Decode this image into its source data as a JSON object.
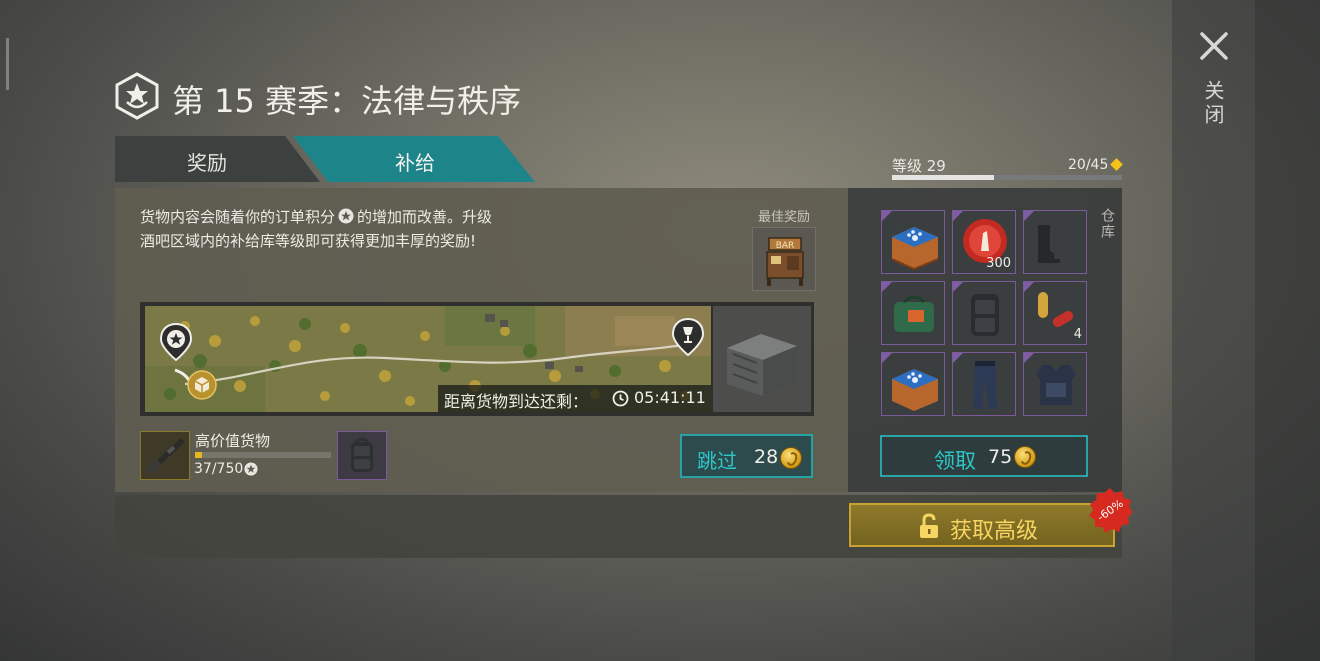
{
  "title": "第 15 赛季：法律与秩序",
  "tabs": [
    {
      "label": "奖励",
      "active": false
    },
    {
      "label": "补给",
      "active": true
    }
  ],
  "level": {
    "label": "等级 29",
    "progress_text": "20/45",
    "progress": 0.444
  },
  "close_label": "关闭",
  "description": {
    "line1_before": "货物内容会随着你的订单积分",
    "line1_after": "的增加而改善。升级",
    "line2": "酒吧区域内的补给库等级即可获得更加丰厚的奖励!"
  },
  "best_reward_label": "最佳奖励",
  "timer": {
    "label": "距离货物到达还剩：",
    "time": "05:41:11"
  },
  "cargo": {
    "label": "高价值货物",
    "count": "37/750",
    "progress": 0.049
  },
  "skip": {
    "label": "跳过",
    "cost": "28"
  },
  "warehouse_label": "仓库",
  "items": [
    {
      "name": "blue-paw-box",
      "count": ""
    },
    {
      "name": "bottle-cap",
      "count": "300"
    },
    {
      "name": "boots",
      "count": ""
    },
    {
      "name": "green-duffel-bag",
      "count": ""
    },
    {
      "name": "tactical-backpack",
      "count": ""
    },
    {
      "name": "ammo",
      "count": "4"
    },
    {
      "name": "blue-paw-box",
      "count": ""
    },
    {
      "name": "tactical-pants",
      "count": ""
    },
    {
      "name": "body-armor",
      "count": ""
    }
  ],
  "claim": {
    "label": "领取",
    "cost": "75"
  },
  "premium": {
    "label": "获取高级",
    "discount": "-60%"
  },
  "colors": {
    "accent_teal": "#1d8589",
    "gold": "#c9a232",
    "discount_red": "#d62a20",
    "item_border": "#7a5a9a"
  }
}
